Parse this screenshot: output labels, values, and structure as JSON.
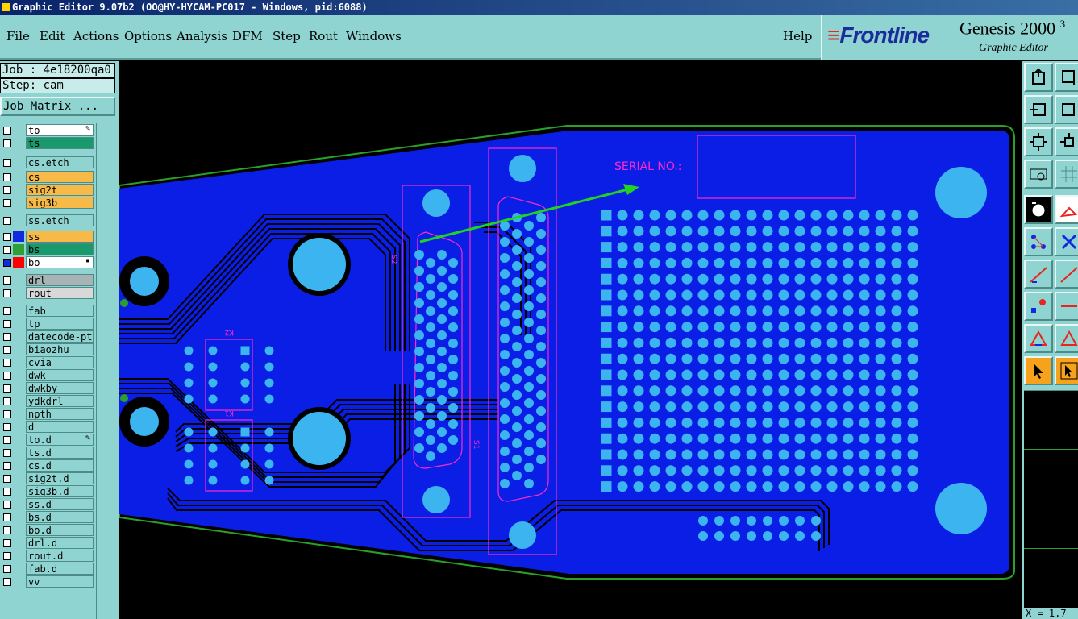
{
  "window": {
    "title": "Graphic Editor 9.07b2 (OO@HY-HYCAM-PC017 - Windows, pid:6088)"
  },
  "menu": {
    "items": [
      "File",
      "Edit",
      "Actions",
      "Options",
      "Analysis",
      "DFM",
      "Step",
      "Rout",
      "Windows"
    ],
    "help": "Help"
  },
  "brand": {
    "logo": "Frontline",
    "product": "Genesis 2000",
    "superscript": "3",
    "subtitle": "Graphic Editor"
  },
  "job": {
    "job_label": "Job : 4e18200qa0",
    "step_label": "Step: cam",
    "matrix_button": "Job Matrix ..."
  },
  "layers": [
    {
      "name": "to",
      "color": "#ffffff",
      "marker": "✎"
    },
    {
      "name": "ts",
      "color": "#1a9a6c"
    },
    {
      "name": "cs.etch",
      "color": "#8fd4d0"
    },
    {
      "name": "cs",
      "color": "#f7b948"
    },
    {
      "name": "sig2t",
      "color": "#f7b948"
    },
    {
      "name": "sig3b",
      "color": "#f7b948"
    },
    {
      "name": "ss.etch",
      "color": "#8fd4d0"
    },
    {
      "name": "ss",
      "color": "#f7b948",
      "swatch": "#1428e0"
    },
    {
      "name": "bs",
      "color": "#1a9a6c",
      "swatch": "#2fa036"
    },
    {
      "name": "bo",
      "color": "#ffffff",
      "swatch": "#ff0000",
      "marker": "▪"
    },
    {
      "name": "drl",
      "color": "#a8b4b4"
    },
    {
      "name": "rout",
      "color": "#d8d8d8"
    },
    {
      "name": "fab",
      "color": "#8fd4d0"
    },
    {
      "name": "tp",
      "color": "#8fd4d0"
    },
    {
      "name": "datecode-pte",
      "color": "#8fd4d0"
    },
    {
      "name": "biaozhu",
      "color": "#8fd4d0"
    },
    {
      "name": "cvia",
      "color": "#8fd4d0"
    },
    {
      "name": "dwk",
      "color": "#8fd4d0"
    },
    {
      "name": "dwkby",
      "color": "#8fd4d0"
    },
    {
      "name": "ydkdrl",
      "color": "#8fd4d0"
    },
    {
      "name": "npth",
      "color": "#8fd4d0"
    },
    {
      "name": "d",
      "color": "#8fd4d0"
    },
    {
      "name": "to.d",
      "color": "#8fd4d0",
      "marker": "✎"
    },
    {
      "name": "ts.d",
      "color": "#8fd4d0"
    },
    {
      "name": "cs.d",
      "color": "#8fd4d0"
    },
    {
      "name": "sig2t.d",
      "color": "#8fd4d0"
    },
    {
      "name": "sig3b.d",
      "color": "#8fd4d0"
    },
    {
      "name": "ss.d",
      "color": "#8fd4d0"
    },
    {
      "name": "bs.d",
      "color": "#8fd4d0"
    },
    {
      "name": "bo.d",
      "color": "#8fd4d0"
    },
    {
      "name": "drl.d",
      "color": "#8fd4d0"
    },
    {
      "name": "rout.d",
      "color": "#8fd4d0"
    },
    {
      "name": "fab.d",
      "color": "#8fd4d0"
    },
    {
      "name": "vv",
      "color": "#8fd4d0"
    }
  ],
  "board": {
    "serial_label": "SERIAL NO.:",
    "silk_labels": [
      "K2",
      "K1",
      "S2",
      "S1"
    ],
    "colors": {
      "board": "#0a1ee6",
      "pad": "#3cb4f0",
      "silk": "#ff2ad0",
      "outline": "#2aa02a",
      "arrow": "#22d322"
    }
  },
  "status": {
    "coord": "X = 1.7"
  }
}
